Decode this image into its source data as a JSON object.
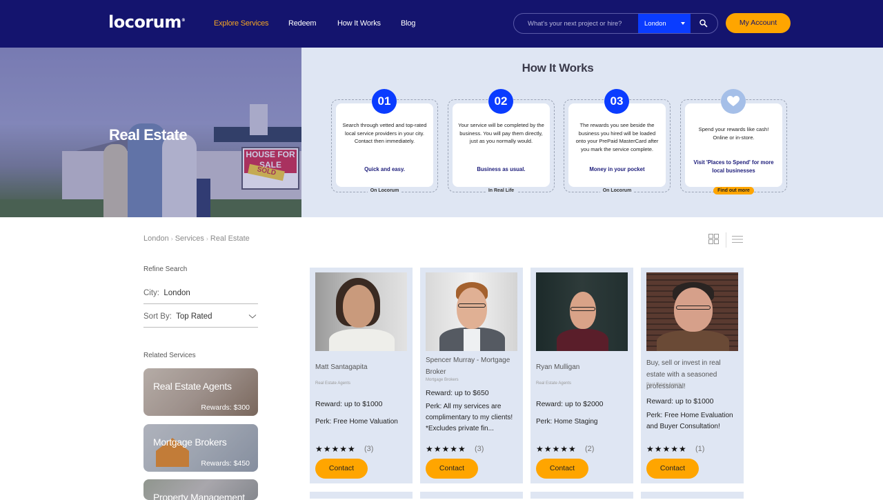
{
  "header": {
    "logo": "locorum",
    "logo_mark": "®",
    "nav": [
      {
        "label": "Explore Services",
        "active": true
      },
      {
        "label": "Redeem",
        "active": false
      },
      {
        "label": "How It Works",
        "active": false
      },
      {
        "label": "Blog",
        "active": false
      }
    ],
    "search": {
      "placeholder": "What's your next project or hire?",
      "city": "London",
      "city_icon": "caret-down-icon",
      "search_icon": "search-icon"
    },
    "account_label": "My Account"
  },
  "hero": {
    "title": "Real Estate",
    "sign_text": "HOUSE FOR SALE",
    "sign_sold": "SOLD"
  },
  "how_it_works": {
    "title": "How It Works",
    "steps": [
      {
        "badge": "01",
        "text": "Search through vetted and top-rated local service providers in your city.\nContact then immediately.",
        "tagline": "Quick and easy.",
        "footer": "On Locorum"
      },
      {
        "badge": "02",
        "text": "Your service will be completed by the business. You will pay them directly, just as you normally would.",
        "tagline": "Business as usual.",
        "footer": "In Real Life"
      },
      {
        "badge": "03",
        "text": "The rewards you see beside the business you hired will be loaded onto your PrePaid MasterCard after you mark the service complete.",
        "tagline": "Money in your pocket",
        "footer": "On Locorum"
      },
      {
        "badge_icon": "heart-icon",
        "text": "Spend your rewards like cash!\nOnline or in-store.",
        "tagline": "Visit 'Places to Spend' for more local businesses",
        "footer_button": "Find out more"
      }
    ]
  },
  "breadcrumb": [
    "London",
    "Services",
    "Real Estate"
  ],
  "view_toggle": {
    "grid_icon": "grid-view-icon",
    "list_icon": "list-view-icon"
  },
  "sidebar": {
    "refine_title": "Refine Search",
    "city_label": "City:",
    "city_value": "London",
    "sort_label": "Sort By:",
    "sort_value": "Top Rated",
    "related_title": "Related Services",
    "related": [
      {
        "title": "Real Estate Agents",
        "rewards": "Rewards: $300"
      },
      {
        "title": "Mortgage Brokers",
        "rewards": "Rewards: $450"
      },
      {
        "title": "Property Management",
        "rewards": ""
      }
    ]
  },
  "listings": [
    {
      "name": "Matt Santagapita",
      "category": "Real Estate Agents",
      "reward": "Reward: up to $1000",
      "perk": "Perk: Free Home Valuation",
      "stars": "★★★★★",
      "rating": 5,
      "reviews": "(3)",
      "contact_label": "Contact"
    },
    {
      "name": "Spencer Murray - Mortgage Broker",
      "category": "Mortgage Brokers",
      "reward": "Reward: up to $650",
      "perk": "Perk: All my services are complimentary to my clients! *Excludes private fin...",
      "stars": "★★★★★",
      "rating": 5,
      "reviews": "(3)",
      "contact_label": "Contact"
    },
    {
      "name": "Ryan Mulligan",
      "category": "Real Estate Agents",
      "reward": "Reward: up to $2000",
      "perk": "Perk: Home Staging",
      "stars": "★★★★★",
      "rating": 5,
      "reviews": "(2)",
      "contact_label": "Contact"
    },
    {
      "name": "Buy, sell or invest in real estate with a seasoned professional!",
      "category": "Real Estate Agents",
      "reward": "Reward: up to $1000",
      "perk": "Perk: Free Home Evaluation and Buyer Consultation!",
      "stars": "★★★★★",
      "rating": 5,
      "reviews": "(1)",
      "contact_label": "Contact"
    }
  ]
}
